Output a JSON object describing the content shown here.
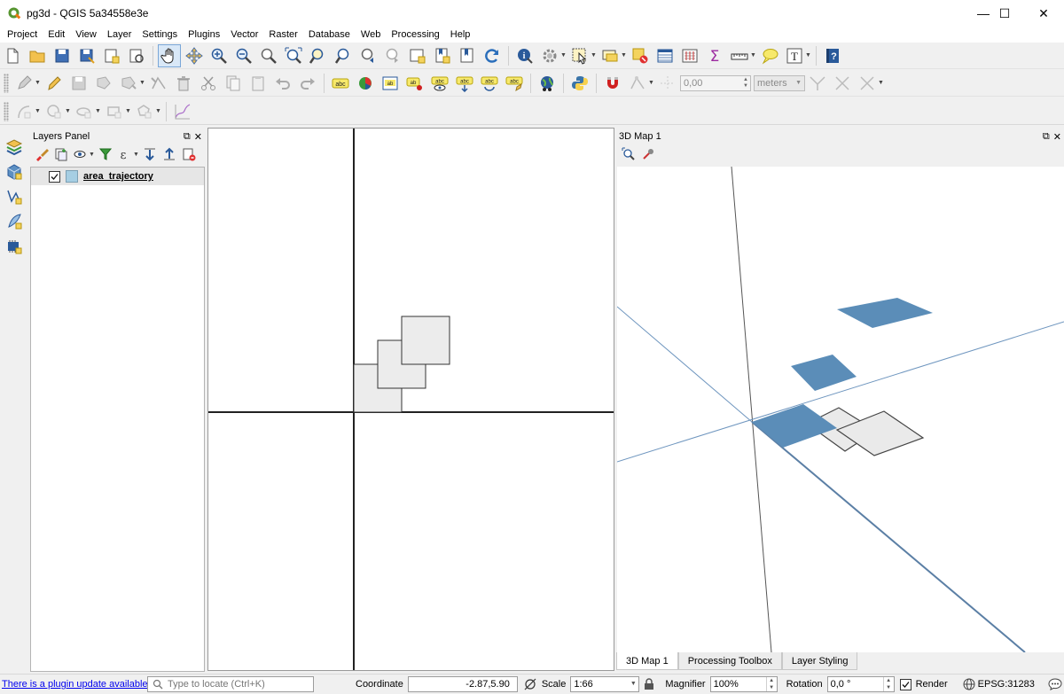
{
  "window": {
    "title": "pg3d - QGIS 5a34558e3e",
    "minimize_glyph": "—",
    "maximize_glyph": "☐",
    "close_glyph": "✕"
  },
  "menu": [
    "Project",
    "Edit",
    "View",
    "Layer",
    "Settings",
    "Plugins",
    "Vector",
    "Raster",
    "Database",
    "Web",
    "Processing",
    "Help"
  ],
  "digitizing_toolbar": {
    "snap_tolerance": "0,00",
    "units": "meters"
  },
  "layers_panel": {
    "title": "Layers Panel",
    "layers": [
      {
        "name": "area_trajectory",
        "checked": true,
        "fill_color": "#a6cee3"
      }
    ]
  },
  "map3d_panel": {
    "title": "3D Map 1",
    "tabs": [
      "3D Map 1",
      "Processing Toolbox",
      "Layer Styling"
    ],
    "active_tab": "3D Map 1",
    "highlight_color": "#5b8db8"
  },
  "status": {
    "plugin_update": "There is a plugin update available",
    "locator_placeholder": "Type to locate (Ctrl+K)",
    "coordinate_label": "Coordinate",
    "coordinate": "-2.87,5.90",
    "scale_label": "Scale",
    "scale": "1:66",
    "magnifier_label": "Magnifier",
    "magnifier": "100%",
    "rotation_label": "Rotation",
    "rotation": "0,0 °",
    "render_label": "Render",
    "render_checked": true,
    "crs": "EPSG:31283"
  },
  "icon_names": [
    "qgis-logo-icon",
    "new-project-icon",
    "open-project-icon",
    "save-project-icon",
    "pan-map-icon",
    "zoom-in-icon",
    "zoom-out-icon",
    "refresh-icon",
    "identify-icon",
    "select-icon",
    "field-calculator-icon",
    "measure-icon",
    "python-icon",
    "magnet-icon",
    "help-icon",
    "check-mark-icon",
    "search-icon",
    "lock-icon",
    "globe-icon",
    "messages-icon"
  ]
}
